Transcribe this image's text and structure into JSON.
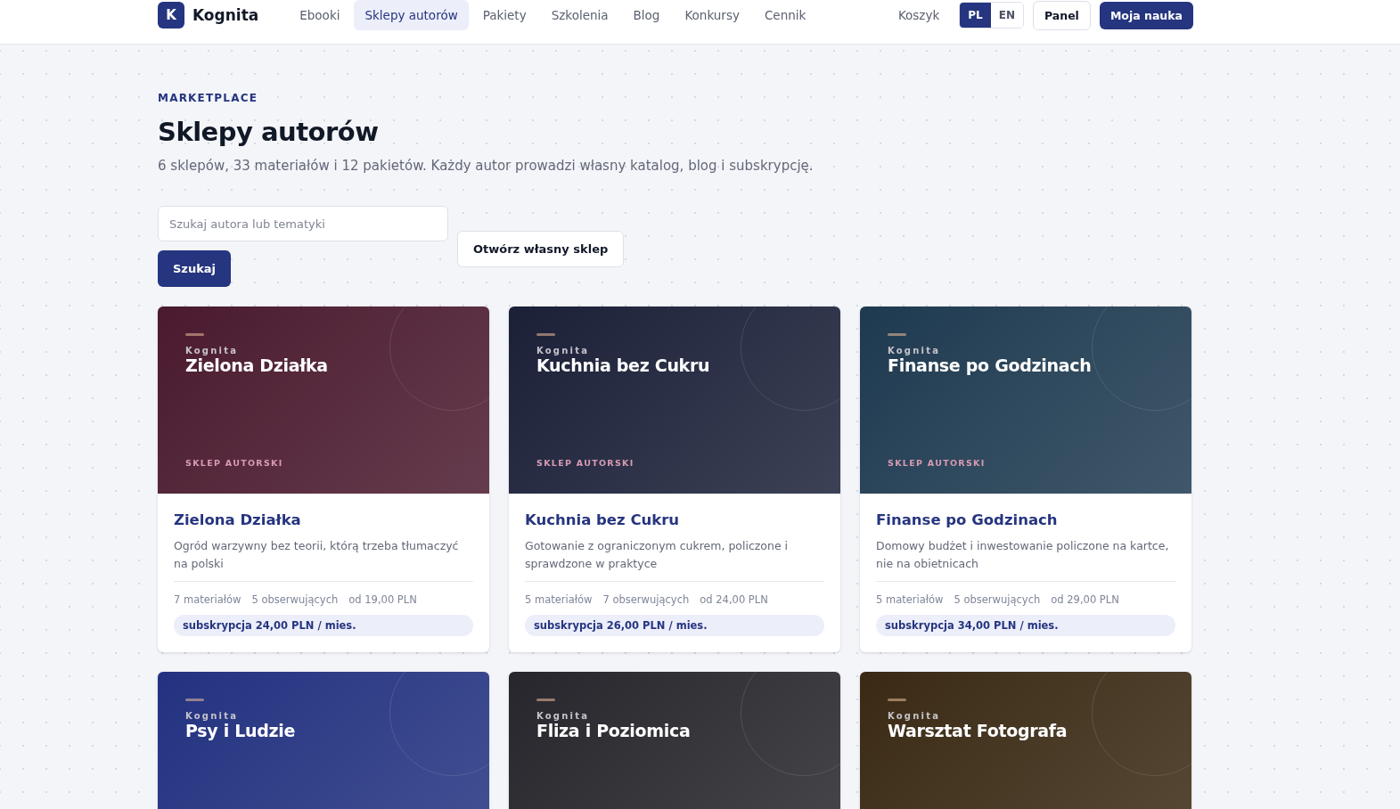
{
  "header": {
    "logo_letter": "K",
    "brand": "Kognita",
    "nav": [
      {
        "label": "Ebooki",
        "selected": false
      },
      {
        "label": "Sklepy autorów",
        "selected": true
      },
      {
        "label": "Pakiety",
        "selected": false
      },
      {
        "label": "Szkolenia",
        "selected": false
      },
      {
        "label": "Blog",
        "selected": false
      },
      {
        "label": "Konkursy",
        "selected": false
      },
      {
        "label": "Cennik",
        "selected": false
      }
    ],
    "cart": "Koszyk",
    "languages": [
      {
        "label": "PL",
        "selected": true
      },
      {
        "label": "EN",
        "selected": false
      }
    ],
    "panel_button": "Panel",
    "primary_button": "Moja nauka"
  },
  "intro": {
    "eyebrow": "MARKETPLACE",
    "title": "Sklepy autorów",
    "subtitle": "6 sklepów, 33 materiałów i 12 pakietów. Każdy autor prowadzi własny katalog, blog i subskrypcję."
  },
  "search": {
    "placeholder": "Szukaj autora lub tematyki",
    "button": "Szukaj",
    "open_shop_button": "Otwórz własny sklep"
  },
  "shops": [
    {
      "color": "#4a1a2e",
      "cover_brand": "Kognita",
      "cover_title": "Zielona Działka",
      "cover_label": "SKLEP AUTORSKI",
      "name": "Zielona Działka",
      "description": "Ogród warzywny bez teorii, którą trzeba tłumaczyć na polski",
      "materials": "7 materiałów",
      "followers": "5 obserwujących",
      "price_from": "od 19,00 PLN",
      "subscription": "subskrypcja 24,00 PLN / mies."
    },
    {
      "color": "#1b2038",
      "cover_brand": "Kognita",
      "cover_title": "Kuchnia bez Cukru",
      "cover_label": "SKLEP AUTORSKI",
      "name": "Kuchnia bez Cukru",
      "description": "Gotowanie z ograniczonym cukrem, policzone i sprawdzone w praktyce",
      "materials": "5 materiałów",
      "followers": "7 obserwujących",
      "price_from": "od 24,00 PLN",
      "subscription": "subskrypcja 26,00 PLN / mies."
    },
    {
      "color": "#1e3a50",
      "cover_brand": "Kognita",
      "cover_title": "Finanse po Godzinach",
      "cover_label": "SKLEP AUTORSKI",
      "name": "Finanse po Godzinach",
      "description": "Domowy budżet i inwestowanie policzone na kartce, nie na obietnicach",
      "materials": "5 materiałów",
      "followers": "5 obserwujących",
      "price_from": "od 29,00 PLN",
      "subscription": "subskrypcja 34,00 PLN / mies."
    },
    {
      "color": "#233280",
      "cover_brand": "Kognita",
      "cover_title": "Psy i Ludzie"
    },
    {
      "color": "#26262c",
      "cover_brand": "Kognita",
      "cover_title": "Fliza i Poziomica"
    },
    {
      "color": "#3a2a14",
      "cover_brand": "Kognita",
      "cover_title": "Warsztat Fotografa"
    }
  ]
}
